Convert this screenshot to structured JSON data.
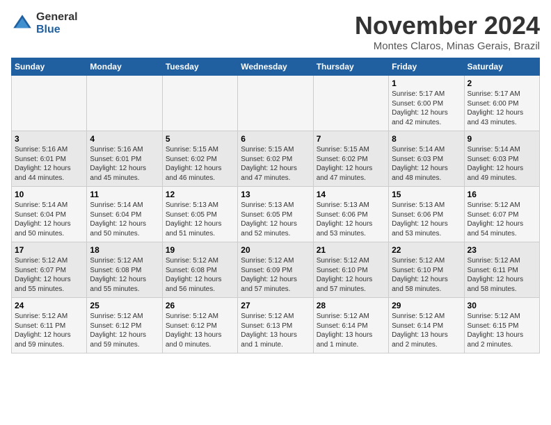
{
  "logo": {
    "general": "General",
    "blue": "Blue"
  },
  "header": {
    "month": "November 2024",
    "location": "Montes Claros, Minas Gerais, Brazil"
  },
  "weekdays": [
    "Sunday",
    "Monday",
    "Tuesday",
    "Wednesday",
    "Thursday",
    "Friday",
    "Saturday"
  ],
  "weeks": [
    [
      {
        "day": "",
        "info": ""
      },
      {
        "day": "",
        "info": ""
      },
      {
        "day": "",
        "info": ""
      },
      {
        "day": "",
        "info": ""
      },
      {
        "day": "",
        "info": ""
      },
      {
        "day": "1",
        "info": "Sunrise: 5:17 AM\nSunset: 6:00 PM\nDaylight: 12 hours\nand 42 minutes."
      },
      {
        "day": "2",
        "info": "Sunrise: 5:17 AM\nSunset: 6:00 PM\nDaylight: 12 hours\nand 43 minutes."
      }
    ],
    [
      {
        "day": "3",
        "info": "Sunrise: 5:16 AM\nSunset: 6:01 PM\nDaylight: 12 hours\nand 44 minutes."
      },
      {
        "day": "4",
        "info": "Sunrise: 5:16 AM\nSunset: 6:01 PM\nDaylight: 12 hours\nand 45 minutes."
      },
      {
        "day": "5",
        "info": "Sunrise: 5:15 AM\nSunset: 6:02 PM\nDaylight: 12 hours\nand 46 minutes."
      },
      {
        "day": "6",
        "info": "Sunrise: 5:15 AM\nSunset: 6:02 PM\nDaylight: 12 hours\nand 47 minutes."
      },
      {
        "day": "7",
        "info": "Sunrise: 5:15 AM\nSunset: 6:02 PM\nDaylight: 12 hours\nand 47 minutes."
      },
      {
        "day": "8",
        "info": "Sunrise: 5:14 AM\nSunset: 6:03 PM\nDaylight: 12 hours\nand 48 minutes."
      },
      {
        "day": "9",
        "info": "Sunrise: 5:14 AM\nSunset: 6:03 PM\nDaylight: 12 hours\nand 49 minutes."
      }
    ],
    [
      {
        "day": "10",
        "info": "Sunrise: 5:14 AM\nSunset: 6:04 PM\nDaylight: 12 hours\nand 50 minutes."
      },
      {
        "day": "11",
        "info": "Sunrise: 5:14 AM\nSunset: 6:04 PM\nDaylight: 12 hours\nand 50 minutes."
      },
      {
        "day": "12",
        "info": "Sunrise: 5:13 AM\nSunset: 6:05 PM\nDaylight: 12 hours\nand 51 minutes."
      },
      {
        "day": "13",
        "info": "Sunrise: 5:13 AM\nSunset: 6:05 PM\nDaylight: 12 hours\nand 52 minutes."
      },
      {
        "day": "14",
        "info": "Sunrise: 5:13 AM\nSunset: 6:06 PM\nDaylight: 12 hours\nand 53 minutes."
      },
      {
        "day": "15",
        "info": "Sunrise: 5:13 AM\nSunset: 6:06 PM\nDaylight: 12 hours\nand 53 minutes."
      },
      {
        "day": "16",
        "info": "Sunrise: 5:12 AM\nSunset: 6:07 PM\nDaylight: 12 hours\nand 54 minutes."
      }
    ],
    [
      {
        "day": "17",
        "info": "Sunrise: 5:12 AM\nSunset: 6:07 PM\nDaylight: 12 hours\nand 55 minutes."
      },
      {
        "day": "18",
        "info": "Sunrise: 5:12 AM\nSunset: 6:08 PM\nDaylight: 12 hours\nand 55 minutes."
      },
      {
        "day": "19",
        "info": "Sunrise: 5:12 AM\nSunset: 6:08 PM\nDaylight: 12 hours\nand 56 minutes."
      },
      {
        "day": "20",
        "info": "Sunrise: 5:12 AM\nSunset: 6:09 PM\nDaylight: 12 hours\nand 57 minutes."
      },
      {
        "day": "21",
        "info": "Sunrise: 5:12 AM\nSunset: 6:10 PM\nDaylight: 12 hours\nand 57 minutes."
      },
      {
        "day": "22",
        "info": "Sunrise: 5:12 AM\nSunset: 6:10 PM\nDaylight: 12 hours\nand 58 minutes."
      },
      {
        "day": "23",
        "info": "Sunrise: 5:12 AM\nSunset: 6:11 PM\nDaylight: 12 hours\nand 58 minutes."
      }
    ],
    [
      {
        "day": "24",
        "info": "Sunrise: 5:12 AM\nSunset: 6:11 PM\nDaylight: 12 hours\nand 59 minutes."
      },
      {
        "day": "25",
        "info": "Sunrise: 5:12 AM\nSunset: 6:12 PM\nDaylight: 12 hours\nand 59 minutes."
      },
      {
        "day": "26",
        "info": "Sunrise: 5:12 AM\nSunset: 6:12 PM\nDaylight: 13 hours\nand 0 minutes."
      },
      {
        "day": "27",
        "info": "Sunrise: 5:12 AM\nSunset: 6:13 PM\nDaylight: 13 hours\nand 1 minute."
      },
      {
        "day": "28",
        "info": "Sunrise: 5:12 AM\nSunset: 6:14 PM\nDaylight: 13 hours\nand 1 minute."
      },
      {
        "day": "29",
        "info": "Sunrise: 5:12 AM\nSunset: 6:14 PM\nDaylight: 13 hours\nand 2 minutes."
      },
      {
        "day": "30",
        "info": "Sunrise: 5:12 AM\nSunset: 6:15 PM\nDaylight: 13 hours\nand 2 minutes."
      }
    ]
  ]
}
